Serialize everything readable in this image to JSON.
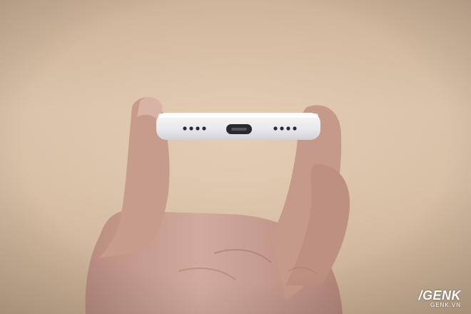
{
  "photo": {
    "subject": "white-phone-bottom-edge",
    "colors": {
      "background": "#d4bca2",
      "skin": "#caa293",
      "phone_body": "#ecebef",
      "port": "#2a2a2e",
      "speaker_holes": "#2c2c30"
    }
  },
  "watermark": {
    "brand": "/GENK",
    "site": "GENK.VN"
  }
}
